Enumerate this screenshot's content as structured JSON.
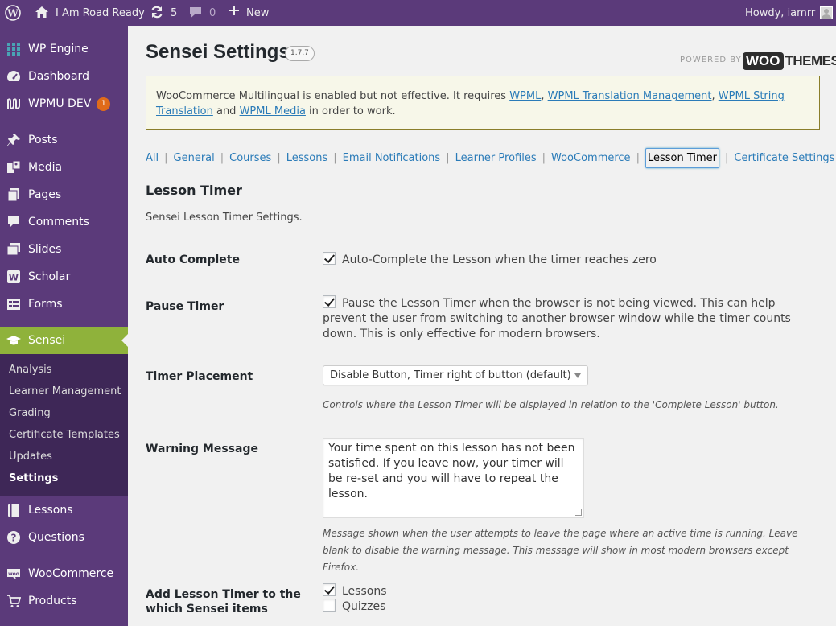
{
  "adminbar": {
    "site_name": "I Am Road Ready",
    "updates_count": "5",
    "comments_count": "0",
    "new_label": "New",
    "howdy": "Howdy, iamrr"
  },
  "sidebar": {
    "items": [
      {
        "label": "WP Engine",
        "icon": "grid-icon"
      },
      {
        "label": "Dashboard",
        "icon": "dashboard-icon"
      },
      {
        "label": "WPMU DEV",
        "icon": "wpmudev-icon",
        "badge": "1"
      },
      {
        "label": "Posts",
        "icon": "pin-icon"
      },
      {
        "label": "Media",
        "icon": "media-icon"
      },
      {
        "label": "Pages",
        "icon": "pages-icon"
      },
      {
        "label": "Comments",
        "icon": "comment-icon"
      },
      {
        "label": "Slides",
        "icon": "slides-icon"
      },
      {
        "label": "Scholar",
        "icon": "scholar-icon"
      },
      {
        "label": "Forms",
        "icon": "forms-icon"
      },
      {
        "label": "Sensei",
        "icon": "graduation-cap-icon"
      },
      {
        "label": "Lessons",
        "icon": "book-icon"
      },
      {
        "label": "Questions",
        "icon": "question-icon"
      },
      {
        "label": "WooCommerce",
        "icon": "woo-icon"
      },
      {
        "label": "Products",
        "icon": "cart-icon"
      }
    ],
    "submenu": [
      "Analysis",
      "Learner Management",
      "Grading",
      "Certificate Templates",
      "Updates",
      "Settings"
    ]
  },
  "header": {
    "title": "Sensei Settings",
    "version": "1.7.7",
    "powered_by": "POWERED BY",
    "logo_woo": "WOO",
    "logo_themes": "THEMES"
  },
  "notice": {
    "text_1": "WooCommerce Multilingual is enabled but not effective. It requires ",
    "link_1": "WPML",
    "sep_1": ", ",
    "link_2": "WPML Translation Management",
    "sep_2": ", ",
    "link_3": "WPML String Translation",
    "text_2": " and ",
    "link_4": "WPML Media",
    "text_3": " in order to work."
  },
  "tabs": [
    "All",
    "General",
    "Courses",
    "Lessons",
    "Email Notifications",
    "Learner Profiles",
    "WooCommerce",
    "Lesson Timer",
    "Certificate Settings"
  ],
  "section": {
    "title": "Lesson Timer",
    "description": "Sensei Lesson Timer Settings."
  },
  "settings": {
    "auto_complete_label": "Auto Complete",
    "auto_complete_text": "Auto-Complete the Lesson when the timer reaches zero",
    "pause_timer_label": "Pause Timer",
    "pause_timer_text": "Pause the Lesson Timer when the browser is not being viewed. This can help prevent the user from switching to another browser window while the timer counts down. This is only effective for modern browsers.",
    "placement_label": "Timer Placement",
    "placement_value": "Disable Button, Timer right of button (default)",
    "placement_help": "Controls where the Lesson Timer will be displayed in relation to the 'Complete Lesson' button.",
    "warning_label": "Warning Message",
    "warning_value": "Your time spent on this lesson has not been satisfied. If you leave now, your timer will be re-set and you will have to repeat the lesson.",
    "warning_help": "Message shown when the user attempts to leave the page where an active time is running. Leave blank to disable the warning message. This message will show in most modern browsers except Firefox.",
    "add_timer_label": "Add Lesson Timer to the which Sensei items",
    "lessons_option": "Lessons",
    "quizzes_option": "Quizzes"
  }
}
